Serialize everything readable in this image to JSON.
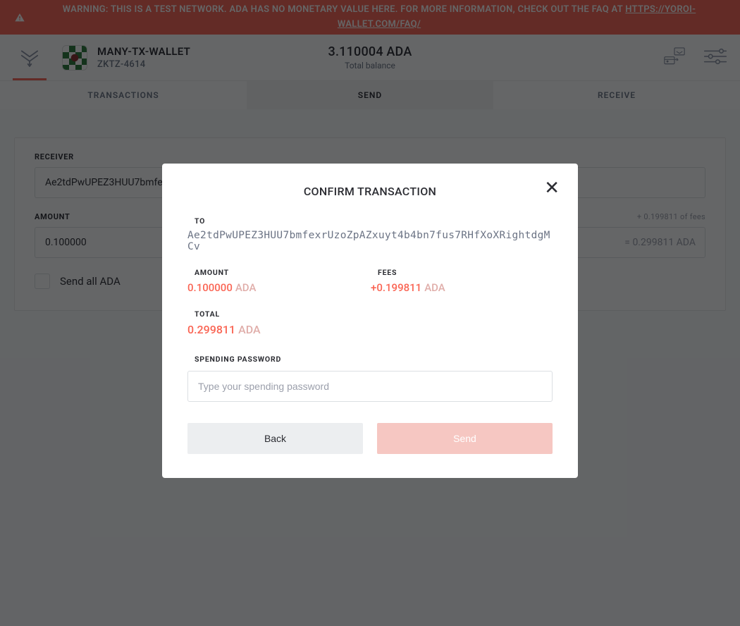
{
  "warning": {
    "text": "WARNING: THIS IS A TEST NETWORK. ADA HAS NO MONETARY VALUE HERE. FOR MORE INFORMATION, CHECK OUT THE FAQ AT ",
    "link_text": "HTTPS://YOROI-WALLET.COM/FAQ/"
  },
  "header": {
    "wallet_name": "MANY-TX-WALLET",
    "wallet_plate": "ZKTZ-4614",
    "balance": "3.110004 ADA",
    "balance_label": "Total balance"
  },
  "tabs": {
    "transactions": "TRANSACTIONS",
    "send": "SEND",
    "receive": "RECEIVE"
  },
  "send_form": {
    "receiver_label": "RECEIVER",
    "receiver_value": "Ae2tdPwUPEZ3HUU7bmfe",
    "amount_label": "AMOUNT",
    "amount_value": "0.100000",
    "fees_hint": "+ 0.199811 of fees",
    "total_hint": "= 0.299811 ADA",
    "send_all_label": "Send all ADA"
  },
  "modal": {
    "title": "CONFIRM TRANSACTION",
    "to_label": "TO",
    "to_value": "Ae2tdPwUPEZ3HUU7bmfexrUzoZpAZxuyt4b4bn7fus7RHfXoXRightdgMCv",
    "amount_label": "AMOUNT",
    "amount_value": "0.100000",
    "amount_currency": "ADA",
    "fees_label": "FEES",
    "fees_value": "+0.199811",
    "fees_currency": "ADA",
    "total_label": "TOTAL",
    "total_value": "0.299811",
    "total_currency": "ADA",
    "password_label": "SPENDING PASSWORD",
    "password_placeholder": "Type your spending password",
    "back_btn": "Back",
    "send_btn": "Send"
  }
}
